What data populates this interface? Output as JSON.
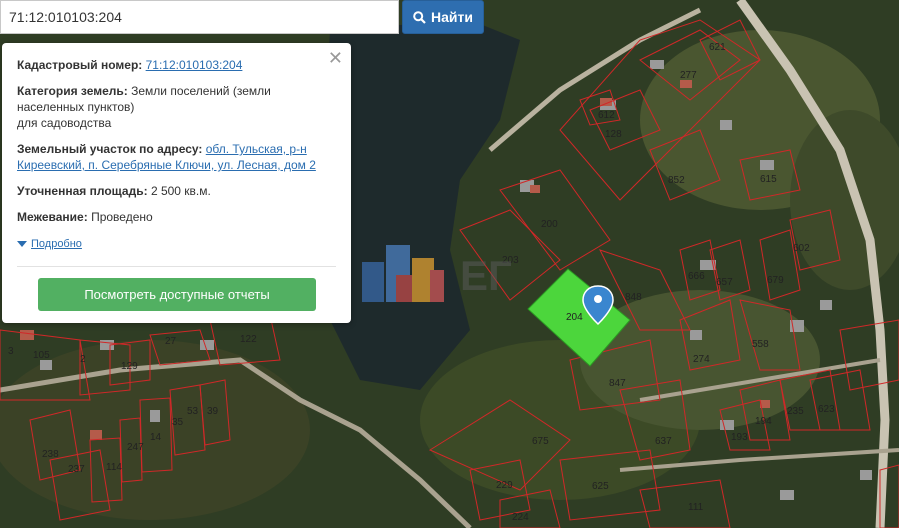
{
  "search": {
    "value": "71:12:010103:204",
    "button_label": "Найти"
  },
  "info": {
    "cadastral_label": "Кадастровый номер:",
    "cadastral_value": "71:12:010103:204",
    "category_label": "Категория земель:",
    "category_value_1": "Земли поселений (земли",
    "category_value_2": "населенных пунктов)",
    "category_value_3": "для садоводства",
    "address_label": "Земельный участок по адресу:",
    "address_value_1": "обл. Тульская, р-н",
    "address_value_2": "Киреевский, п. Серебряные Ключи, ул. Лесная, дом 2",
    "area_label": "Уточненная площадь:",
    "area_value": "2 500 кв.м.",
    "survey_label": "Межевание:",
    "survey_value": "Проведено",
    "more_label": "Подробно",
    "report_button": "Посмотреть доступные отчеты"
  },
  "parcels": [
    "621",
    "277",
    "128",
    "612",
    "852",
    "615",
    "200",
    "203",
    "204",
    "848",
    "666",
    "657",
    "679",
    "602",
    "558",
    "274",
    "847",
    "637",
    "675",
    "625",
    "229",
    "224",
    "111",
    "194",
    "235",
    "623",
    "193",
    "105",
    "2",
    "129",
    "27",
    "122",
    "53",
    "39",
    "35",
    "14",
    "247",
    "238",
    "237",
    "114",
    "3"
  ],
  "watermark": "ЕГ",
  "colors": {
    "selected_parcel": "#4cd63c",
    "parcel_border": "#d02828",
    "search_button": "#2e6eb0",
    "report_button": "#52b062",
    "marker": "#3a86cf"
  }
}
